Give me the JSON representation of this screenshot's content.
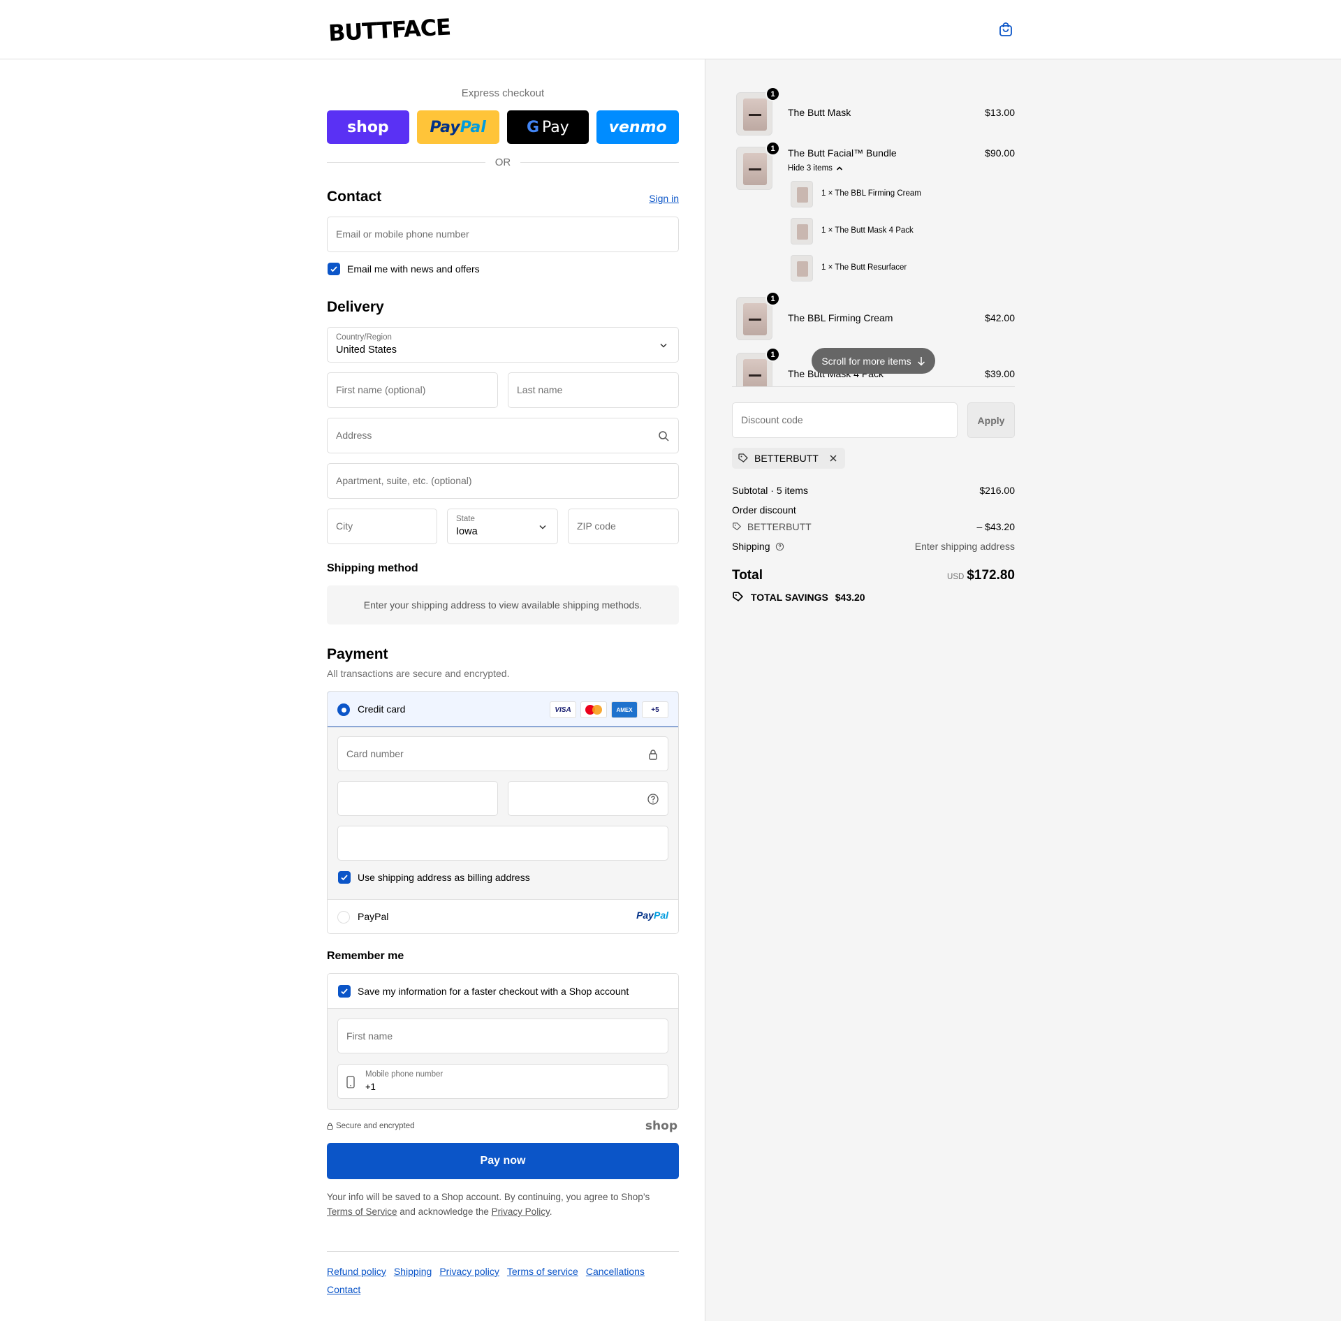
{
  "header": {
    "logo_text": "BUTTFACE",
    "cart_icon": "shopping-bag-icon"
  },
  "express": {
    "title": "Express checkout",
    "buttons": {
      "shop": "shop",
      "paypal_a": "Pay",
      "paypal_b": "Pal",
      "gpay_g": "G",
      "gpay": "Pay",
      "venmo": "venmo"
    },
    "or": "OR"
  },
  "contact": {
    "heading": "Contact",
    "sign_in": "Sign in",
    "email_placeholder": "Email or mobile phone number",
    "newsletter_label": "Email me with news and offers"
  },
  "delivery": {
    "heading": "Delivery",
    "country_label": "Country/Region",
    "country_value": "United States",
    "first_name": "First name (optional)",
    "last_name": "Last name",
    "address": "Address",
    "apartment": "Apartment, suite, etc. (optional)",
    "city": "City",
    "state_label": "State",
    "state_value": "Iowa",
    "zip": "ZIP code"
  },
  "shipping_method": {
    "heading": "Shipping method",
    "message": "Enter your shipping address to view available shipping methods."
  },
  "payment": {
    "heading": "Payment",
    "subtitle": "All transactions are secure and encrypted.",
    "credit_card_label": "Credit card",
    "card_logos": {
      "visa": "VISA",
      "amex": "AMEX",
      "more": "+5"
    },
    "card_number": "Card number",
    "billing_label": "Use shipping address as billing address",
    "paypal_label": "PayPal",
    "paypal_logo_a": "Pay",
    "paypal_logo_b": "Pal"
  },
  "remember": {
    "heading": "Remember me",
    "save_label": "Save my information for a faster checkout with a Shop account",
    "first_name": "First name",
    "phone_label": "Mobile phone number",
    "phone_value": "+1"
  },
  "secure": {
    "text": "Secure and encrypted",
    "shop": "shop"
  },
  "pay_now": "Pay now",
  "legal": {
    "text1": "Your info will be saved to a Shop account. By continuing, you agree to Shop’s",
    "tos": "Terms of Service",
    "text2": "and acknowledge the",
    "privacy": "Privacy Policy",
    "text3": "."
  },
  "footer": {
    "links": [
      "Refund policy",
      "Shipping",
      "Privacy policy",
      "Terms of service",
      "Cancellations",
      "Contact"
    ]
  },
  "summary": {
    "items": [
      {
        "name": "The Butt Mask",
        "price": "$13.00",
        "qty": "1"
      },
      {
        "name": "The Butt Facial™ Bundle",
        "price": "$90.00",
        "qty": "1",
        "hide_label": "Hide 3 items",
        "sub_items": [
          "1 × The BBL Firming Cream",
          "1 × The Butt Mask 4 Pack",
          "1 × The Butt Resurfacer"
        ]
      },
      {
        "name": "The BBL Firming Cream",
        "price": "$42.00",
        "qty": "1"
      },
      {
        "name": "The Butt Mask 4 Pack",
        "price": "$39.00",
        "qty": "1"
      }
    ],
    "scroll_hint": "Scroll for more items",
    "discount_placeholder": "Discount code",
    "apply": "Apply",
    "applied_code": "BETTERBUTT",
    "subtotal_label": "Subtotal · 5 items",
    "subtotal_value": "$216.00",
    "order_discount_label": "Order discount",
    "discount_code": "BETTERBUTT",
    "discount_value": "– $43.20",
    "shipping_label": "Shipping",
    "shipping_value": "Enter shipping address",
    "total_label": "Total",
    "currency": "USD",
    "total_value": "$172.80",
    "savings_label": "TOTAL SAVINGS",
    "savings_value": "$43.20"
  },
  "colors": {
    "accent": "#0b55c8",
    "shop": "#5a31f4",
    "paypal": "#ffc439",
    "venmo": "#008cff"
  }
}
